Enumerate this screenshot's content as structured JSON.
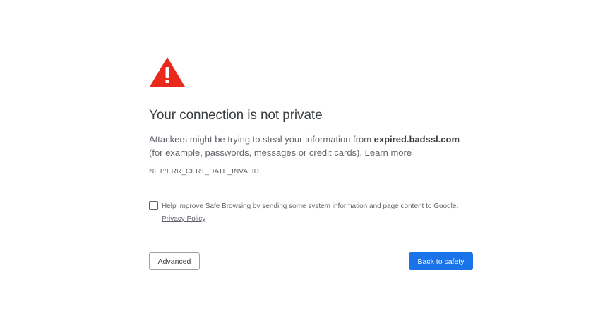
{
  "warning": {
    "icon": "warning-triangle-icon",
    "color": "#e8291c"
  },
  "heading": "Your connection is not private",
  "message": {
    "prefix": "Attackers might be trying to steal your information from ",
    "domain": "expired.badssl.com",
    "suffix": " (for example, passwords, messages or credit cards). ",
    "learn_more": "Learn more"
  },
  "error_code": "NET::ERR_CERT_DATE_INVALID",
  "safe_browsing": {
    "checked": false,
    "prefix": "Help improve Safe Browsing by sending some ",
    "link": "system information and page content",
    "suffix": " to Google. ",
    "privacy_link": "Privacy Policy"
  },
  "buttons": {
    "advanced": "Advanced",
    "back_to_safety": "Back to safety"
  },
  "colors": {
    "primary": "#1a73e8",
    "warning": "#e8291c",
    "text": "#5f6368"
  }
}
